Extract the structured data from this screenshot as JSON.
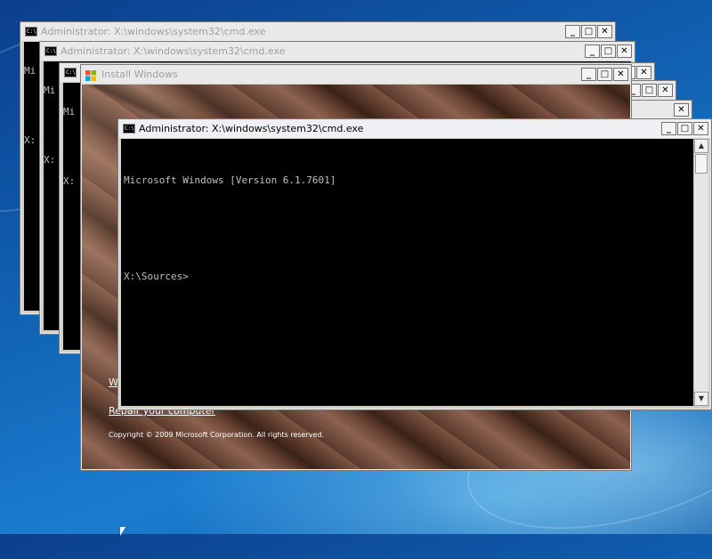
{
  "windows": {
    "cmd_back_1": {
      "title": "Administrator: X:\\windows\\system32\\cmd.exe",
      "lines": [
        "Mi",
        "",
        "X:"
      ]
    },
    "cmd_back_2": {
      "title": "Administrator: X:\\windows\\system32\\cmd.exe",
      "lines": [
        "Mi",
        "",
        "X:"
      ]
    },
    "cmd_back_3": {
      "title": "",
      "lines": [
        "Mi",
        "",
        "X:"
      ]
    },
    "install": {
      "title": "Install Windows",
      "link_partial": "W",
      "repair_text": "Repair your computer",
      "copyright": "Copyright © 2009 Microsoft Corporation. All rights reserved."
    },
    "cmd_front": {
      "title": "Administrator: X:\\windows\\system32\\cmd.exe",
      "line1": "Microsoft Windows [Version 6.1.7601]",
      "line2": "",
      "line3": "X:\\Sources>"
    }
  },
  "window_buttons": {
    "minimize": "_",
    "maximize": "□",
    "close": "✕"
  },
  "icons": {
    "cmd": "cmd-icon",
    "install": "windows-flag-icon"
  }
}
